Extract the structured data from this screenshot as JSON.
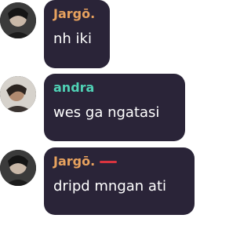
{
  "messages": [
    {
      "author": "Jargō.",
      "text": "nh iki",
      "name_color": "#e8a25e"
    },
    {
      "author": "andra",
      "text": "wes ga ngatasi",
      "name_color": "#4fd1b5"
    },
    {
      "author": "Jargō.",
      "text": "dripd mngan ati",
      "name_color": "#e8a25e"
    }
  ]
}
